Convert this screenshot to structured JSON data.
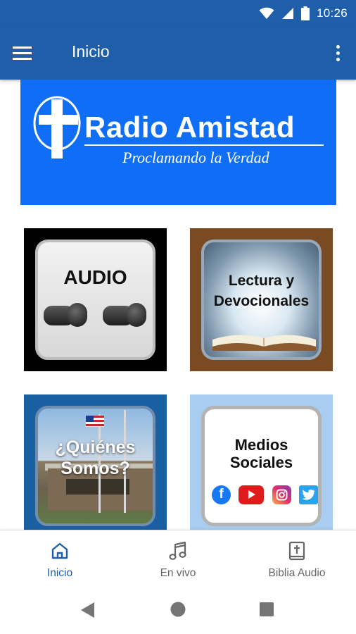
{
  "status_bar": {
    "time": "10:26",
    "icons": [
      "wifi-icon",
      "signal-icon",
      "battery-icon"
    ]
  },
  "app_bar": {
    "title": "Inicio",
    "menu_icon": "hamburger-menu-icon",
    "overflow_icon": "more-vertical-icon"
  },
  "banner": {
    "title": "Radio Amistad",
    "subtitle": "Proclamando la Verdad",
    "logo_icon": "cross-logo-icon"
  },
  "tiles": {
    "audio": {
      "label": "AUDIO"
    },
    "lectura": {
      "line1": "Lectura y",
      "line2": "Devocionales"
    },
    "quienes": {
      "line1": "¿Quiénes",
      "line2": "Somos?"
    },
    "medios": {
      "line1": "Medios",
      "line2": "Sociales",
      "icons": [
        "facebook-icon",
        "youtube-icon",
        "instagram-icon",
        "twitter-icon"
      ]
    }
  },
  "bottom_nav": {
    "items": [
      {
        "label": "Inicio",
        "icon": "home-icon",
        "active": true
      },
      {
        "label": "En vivo",
        "icon": "music-note-icon",
        "active": false
      },
      {
        "label": "Biblia Audio",
        "icon": "bible-icon",
        "active": false
      }
    ]
  },
  "colors": {
    "primary": "#1f5faa",
    "banner": "#0f6ef5",
    "inactive": "#666666"
  }
}
